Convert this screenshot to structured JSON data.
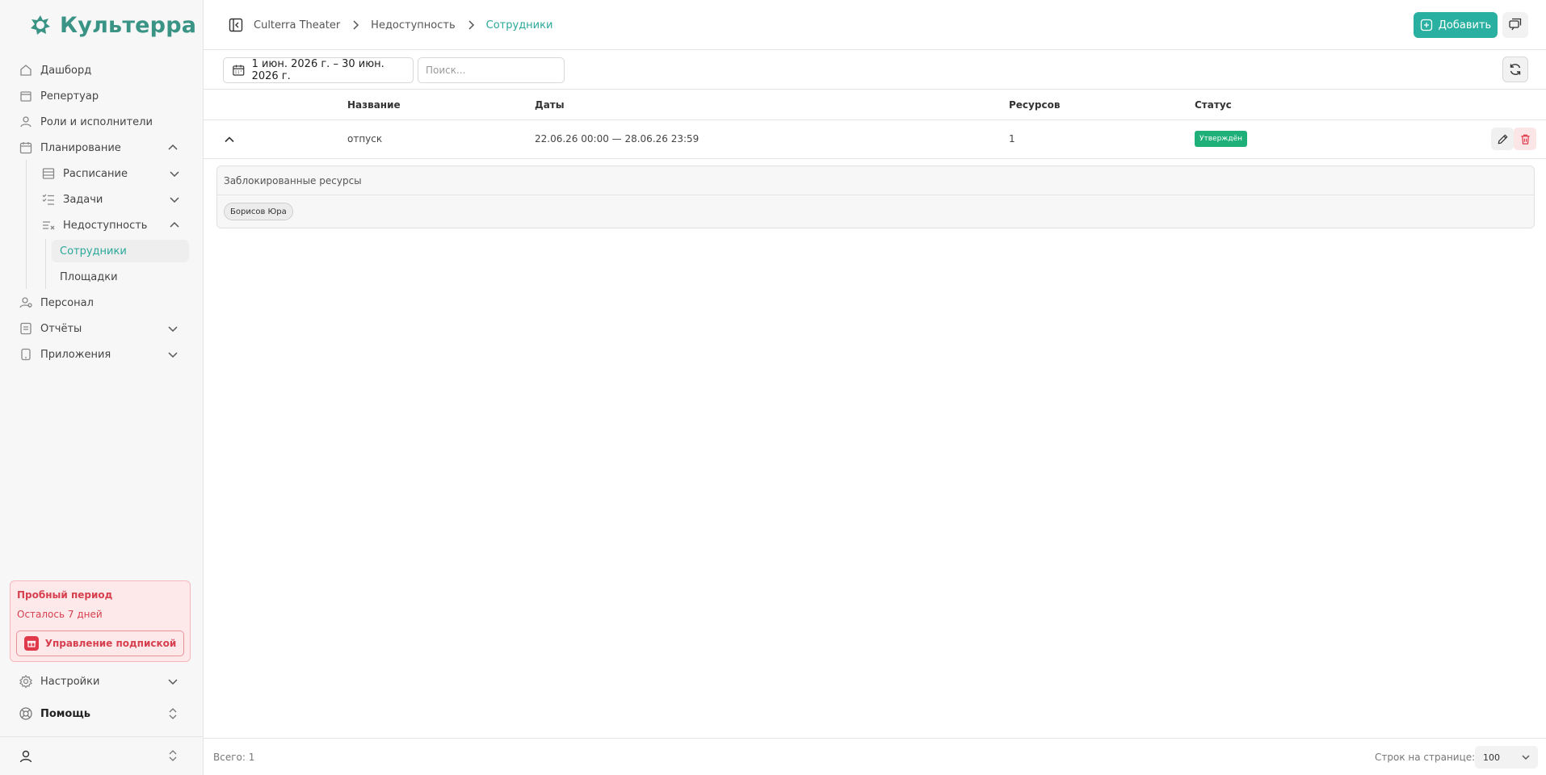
{
  "brand": {
    "name": "Культерра",
    "accent": "#2ab0a0"
  },
  "sidebar": {
    "items": [
      {
        "label": "Дашборд",
        "icon": "home-icon"
      },
      {
        "label": "Репертуар",
        "icon": "theater-icon"
      },
      {
        "label": "Роли и исполнители",
        "icon": "roles-icon"
      },
      {
        "label": "Планирование",
        "icon": "calendar-icon"
      },
      {
        "label": "Расписание",
        "icon": "schedule-icon"
      },
      {
        "label": "Задачи",
        "icon": "tasks-icon"
      },
      {
        "label": "Недоступность",
        "icon": "unavailability-icon"
      },
      {
        "label": "Сотрудники"
      },
      {
        "label": "Площадки"
      },
      {
        "label": "Персонал",
        "icon": "staff-icon"
      },
      {
        "label": "Отчёты",
        "icon": "reports-icon"
      },
      {
        "label": "Приложения",
        "icon": "apps-icon"
      }
    ],
    "trial": {
      "title": "Пробный период",
      "remaining": "Осталось 7 дней",
      "button": "Управление подпиской"
    },
    "settings": "Настройки",
    "help": "Помощь"
  },
  "header": {
    "breadcrumbs": [
      "Culterra Theater",
      "Недоступность",
      "Сотрудники"
    ],
    "add_label": "Добавить"
  },
  "toolbar": {
    "date_range": "1 июн. 2026 г. – 30 июн. 2026 г.",
    "search_placeholder": "Поиск..."
  },
  "table": {
    "columns": [
      "Название",
      "Даты",
      "Ресурсов",
      "Статус"
    ],
    "rows": [
      {
        "name": "отпуск",
        "dates": "22.06.26 00:00 — 28.06.26 23:59",
        "resources": "1",
        "status": "Утверждён"
      }
    ],
    "details": {
      "title": "Заблокированные ресурсы",
      "resources": [
        "Борисов Юра"
      ]
    }
  },
  "footer": {
    "total": "Всего: 1",
    "per_page_label": "Строк на странице:",
    "per_page_value": "100"
  }
}
